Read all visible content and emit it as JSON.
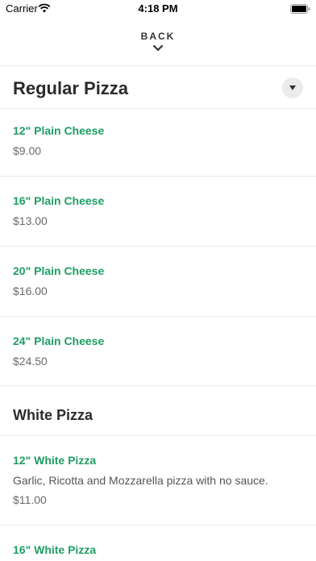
{
  "status_bar": {
    "carrier": "Carrier",
    "time": "4:18 PM",
    "wifi_icon": "wifi-icon",
    "battery_icon": "battery-icon"
  },
  "nav": {
    "back_label": "BACK",
    "back_icon": "chevron-down-icon"
  },
  "sections": [
    {
      "title": "Regular Pizza",
      "dropdown_icon": "caret-down-icon",
      "items": [
        {
          "name": "12\" Plain Cheese",
          "price": "$9.00"
        },
        {
          "name": "16\" Plain Cheese",
          "price": "$13.00"
        },
        {
          "name": "20\" Plain Cheese",
          "price": "$16.00"
        },
        {
          "name": "24\" Plain Cheese",
          "price": "$24.50"
        }
      ]
    },
    {
      "title": "White Pizza",
      "items": [
        {
          "name": "12\" White Pizza",
          "description": "Garlic, Ricotta and Mozzarella pizza with no sauce.",
          "price": "$11.00"
        },
        {
          "name": "16\" White Pizza"
        }
      ]
    }
  ],
  "colors": {
    "item_name": "#1e9e63",
    "text": "#2b2b2b",
    "divider": "#e8e8e8"
  }
}
